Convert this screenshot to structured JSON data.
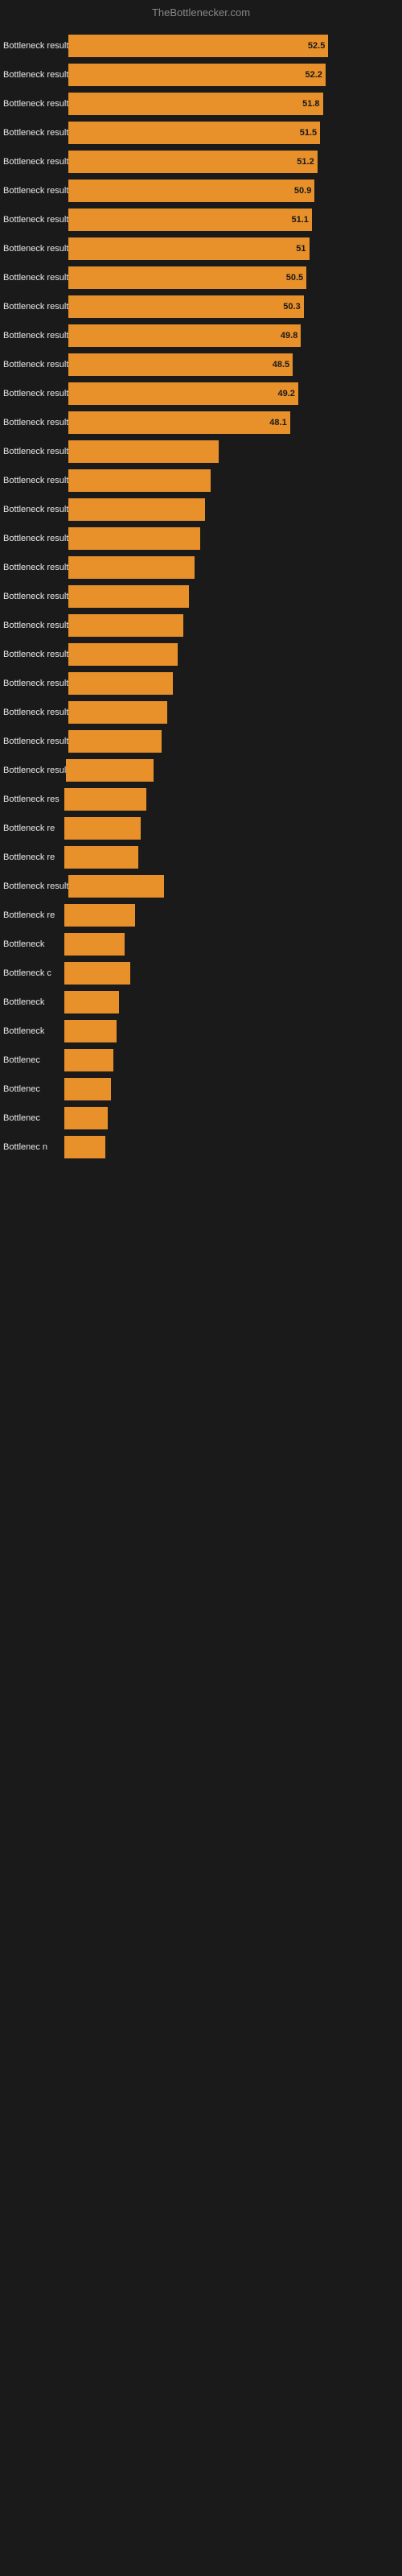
{
  "header": {
    "title": "TheBottlenecker.com"
  },
  "bars": [
    {
      "label": "Bottleneck result",
      "value": 52.5,
      "width_pct": 95
    },
    {
      "label": "Bottleneck result",
      "value": 52.2,
      "width_pct": 94
    },
    {
      "label": "Bottleneck result",
      "value": 51.8,
      "width_pct": 93
    },
    {
      "label": "Bottleneck result",
      "value": 51.5,
      "width_pct": 92
    },
    {
      "label": "Bottleneck result",
      "value": 51.2,
      "width_pct": 91
    },
    {
      "label": "Bottleneck result",
      "value": 50.9,
      "width_pct": 90
    },
    {
      "label": "Bottleneck result",
      "value": 51.1,
      "width_pct": 89
    },
    {
      "label": "Bottleneck result",
      "value": 51.0,
      "width_pct": 88
    },
    {
      "label": "Bottleneck result",
      "value": 50.5,
      "width_pct": 87
    },
    {
      "label": "Bottleneck result",
      "value": 50.3,
      "width_pct": 86
    },
    {
      "label": "Bottleneck result",
      "value": 49.8,
      "width_pct": 85
    },
    {
      "label": "Bottleneck result",
      "value": 48.5,
      "width_pct": 82
    },
    {
      "label": "Bottleneck result",
      "value": 49.2,
      "width_pct": 84
    },
    {
      "label": "Bottleneck result",
      "value": 48.1,
      "width_pct": 81
    },
    {
      "label": "Bottleneck result",
      "value": null,
      "width_pct": 55
    },
    {
      "label": "Bottleneck result",
      "value": null,
      "width_pct": 52
    },
    {
      "label": "Bottleneck result",
      "value": null,
      "width_pct": 50
    },
    {
      "label": "Bottleneck result",
      "value": null,
      "width_pct": 48
    },
    {
      "label": "Bottleneck result",
      "value": null,
      "width_pct": 46
    },
    {
      "label": "Bottleneck result",
      "value": null,
      "width_pct": 44
    },
    {
      "label": "Bottleneck result",
      "value": null,
      "width_pct": 42
    },
    {
      "label": "Bottleneck result",
      "value": null,
      "width_pct": 40
    },
    {
      "label": "Bottleneck result",
      "value": null,
      "width_pct": 38
    },
    {
      "label": "Bottleneck result",
      "value": null,
      "width_pct": 36
    },
    {
      "label": "Bottleneck result",
      "value": null,
      "width_pct": 34
    },
    {
      "label": "Bottleneck resul",
      "value": null,
      "width_pct": 32
    },
    {
      "label": "Bottleneck res",
      "value": null,
      "width_pct": 30
    },
    {
      "label": "Bottleneck re",
      "value": null,
      "width_pct": 28
    },
    {
      "label": "Bottleneck re",
      "value": null,
      "width_pct": 27
    },
    {
      "label": "Bottleneck result",
      "value": null,
      "width_pct": 35
    },
    {
      "label": "Bottleneck re",
      "value": null,
      "width_pct": 26
    },
    {
      "label": "Bottleneck",
      "value": null,
      "width_pct": 22
    },
    {
      "label": "Bottleneck c",
      "value": null,
      "width_pct": 24
    },
    {
      "label": "Bottleneck",
      "value": null,
      "width_pct": 20
    },
    {
      "label": "Bottleneck",
      "value": null,
      "width_pct": 19
    },
    {
      "label": "Bottlenec",
      "value": null,
      "width_pct": 18
    },
    {
      "label": "Bottlenec",
      "value": null,
      "width_pct": 17
    },
    {
      "label": "Bottlenec",
      "value": null,
      "width_pct": 16
    },
    {
      "label": "Bottlenec n",
      "value": null,
      "width_pct": 15
    }
  ]
}
